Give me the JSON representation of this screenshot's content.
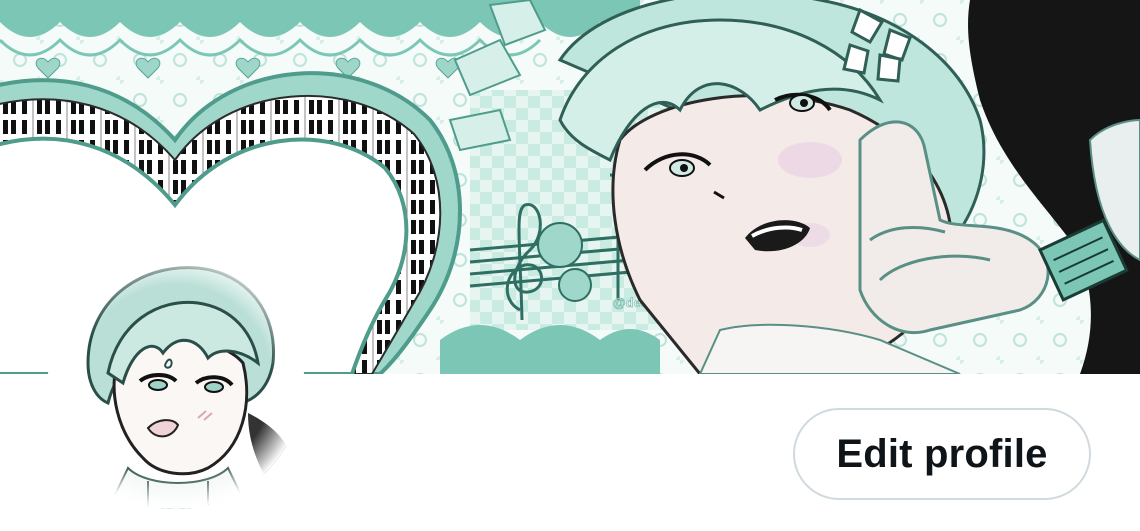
{
  "profile": {
    "edit_profile_label": "Edit profile"
  },
  "banner": {
    "watermark_text": "@decievedhearts",
    "accent_color": "#7cc6b6",
    "alt": "profile-banner"
  },
  "avatar": {
    "alt": "profile-avatar"
  },
  "colors": {
    "button_border": "#cfd9de",
    "button_text": "#0f1419",
    "mint": "#7cc6b6",
    "mint_light": "#c8ebe2"
  }
}
